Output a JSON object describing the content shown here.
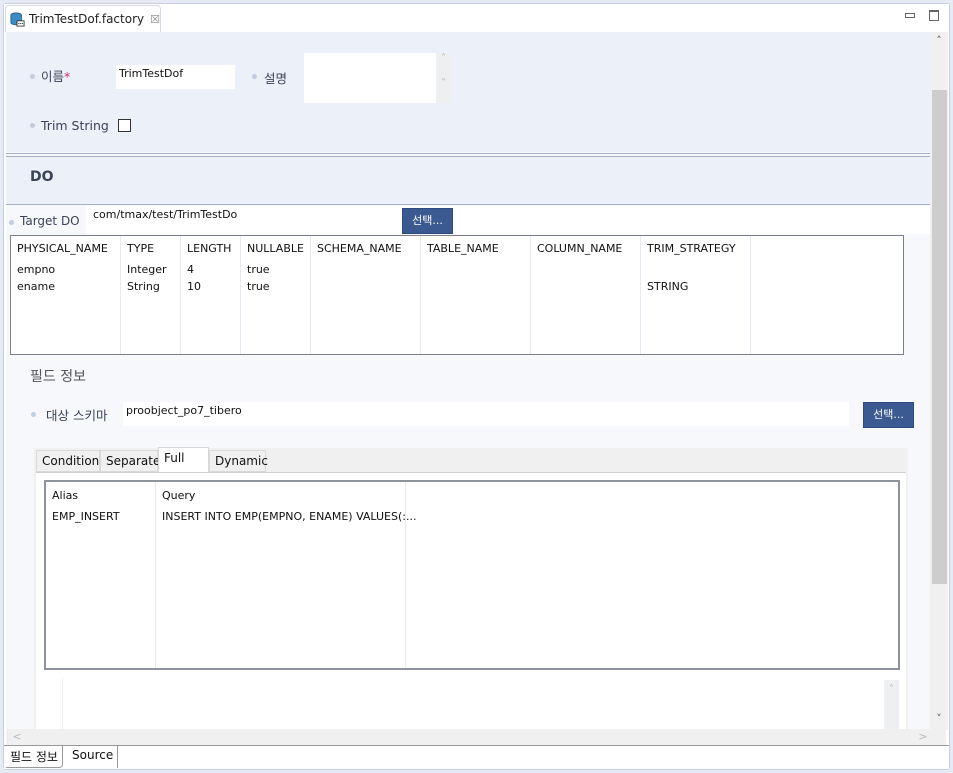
{
  "editor_tab": {
    "title": "TrimTestDof.factory",
    "icon": "database-icon",
    "close_icon": "close-icon"
  },
  "window_controls": {
    "minimize": "minimize-icon",
    "maximize": "maximize-icon"
  },
  "general": {
    "name_label": "이름",
    "required_mark": "*",
    "name_value": "TrimTestDof",
    "desc_label": "설명",
    "desc_value": "",
    "trim_label": "Trim String",
    "trim_checked": false
  },
  "do_section": {
    "title": "DO",
    "target_label": "Target DO",
    "target_value": "com/tmax/test/TrimTestDo",
    "select_button": "선택...",
    "columns": [
      "PHYSICAL_NAME",
      "TYPE",
      "LENGTH",
      "NULLABLE",
      "SCHEMA_NAME",
      "TABLE_NAME",
      "COLUMN_NAME",
      "TRIM_STRATEGY"
    ],
    "rows": [
      [
        "empno",
        "Integer",
        "4",
        "true",
        "",
        "",
        "",
        ""
      ],
      [
        "ename",
        "String",
        "10",
        "true",
        "",
        "",
        "",
        "STRING"
      ]
    ]
  },
  "field_info": {
    "title": "필드 정보",
    "schema_label": "대상 스키마",
    "schema_value": "proobject_po7_tibero",
    "select_button": "선택...",
    "tabs": [
      "Condition",
      "Separate",
      "Full",
      "Dynamic"
    ],
    "active_tab": "Full",
    "query_columns": [
      "Alias",
      "Query"
    ],
    "query_rows": [
      [
        "EMP_INSERT",
        "INSERT INTO EMP(EMPNO, ENAME) VALUES(:..."
      ]
    ]
  },
  "bottom_tabs": [
    "필드 정보",
    "Source"
  ],
  "active_bottom_tab": "필드 정보"
}
